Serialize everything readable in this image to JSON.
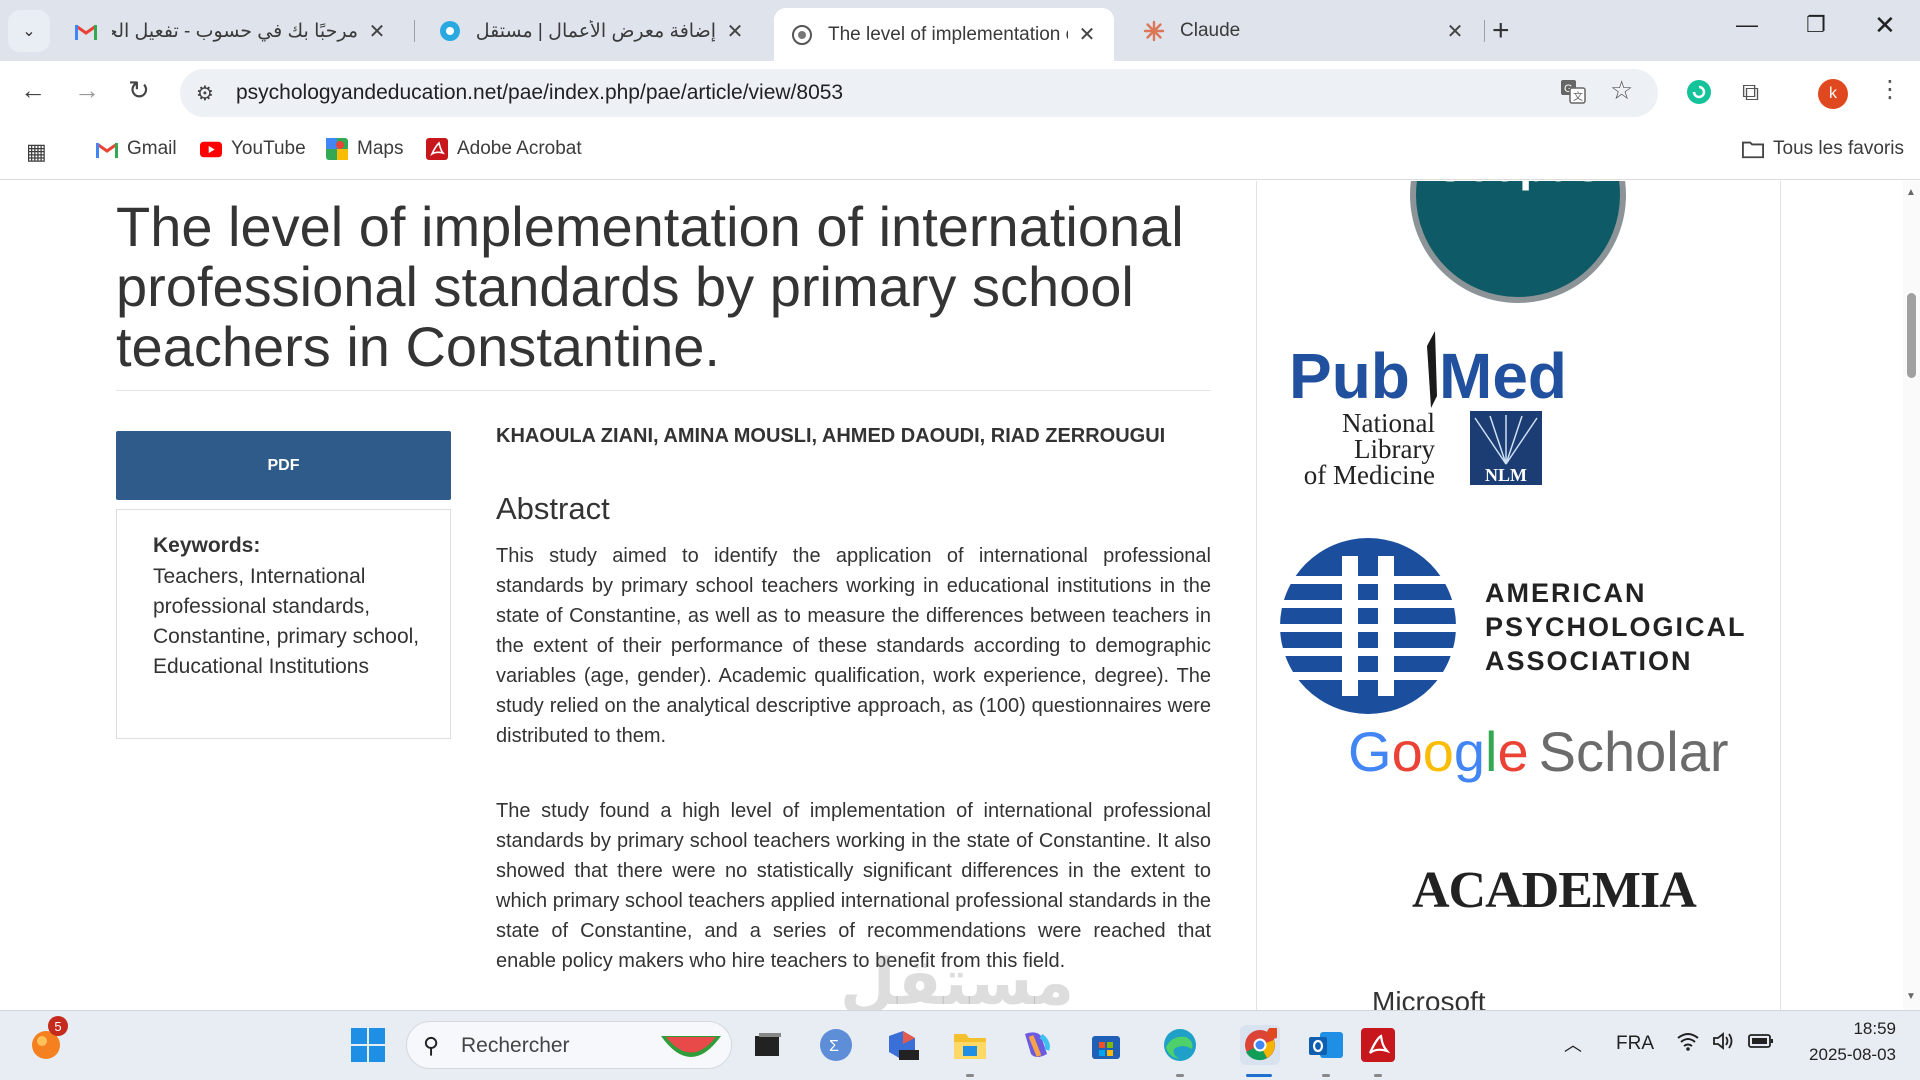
{
  "browser": {
    "tabs": [
      {
        "title": "مرحبًا بك في حسوب - تفعيل الحسا",
        "icon": "gmail-icon"
      },
      {
        "title": "إضافة معرض الأعمال | مستقل",
        "icon": "mostaql-icon"
      },
      {
        "title": "The level of implementation of i",
        "icon": "globe-icon"
      },
      {
        "title": "Claude",
        "icon": "claude-icon"
      }
    ],
    "url": "psychologyandeducation.net/pae/index.php/pae/article/view/8053",
    "avatar_letter": "k",
    "bookmarks": [
      {
        "label": "Gmail",
        "icon": "gmail-icon"
      },
      {
        "label": "YouTube",
        "icon": "youtube-icon"
      },
      {
        "label": "Maps",
        "icon": "maps-icon"
      },
      {
        "label": "Adobe Acrobat",
        "icon": "acrobat-icon"
      }
    ],
    "all_bookmarks": "Tous les favoris"
  },
  "article": {
    "title": "The level of implementation of international professional standards by primary school teachers in Constantine.",
    "pdf_label": "PDF",
    "keywords_heading": "Keywords:",
    "keywords": "Teachers, International professional standards, Constantine, primary school, Educational Institutions",
    "authors": "KHAOULA ZIANI, AMINA MOUSLI, AHMED DAOUDI, RIAD ZERROUGUI",
    "abstract_heading": "Abstract",
    "abstract_p1": "This study aimed to identify the application of international professional standards by primary school teachers working in educational institutions in the state of Constantine, as well as to measure the differences between teachers in the extent of their performance of these standards according to demographic variables (age, gender). Academic qualification, work experience, degree). The study relied on the analytical descriptive approach, as (100) questionnaires were distributed to them.",
    "abstract_p2": "The study found a high level of implementation of international professional standards by primary school teachers working in the state of Constantine. It also showed that there were no statistically significant differences in the extent to which primary school teachers applied international professional standards in the state of Constantine, and a series of recommendations were reached that enable policy makers who hire teachers to benefit from this field."
  },
  "sidebar": {
    "scopus": "Scopus",
    "pubmed_pub": "Pub",
    "pubmed_med": "Med",
    "nlm_lines": [
      "National",
      "Library",
      "of Medicine"
    ],
    "nlm_badge": "NLM",
    "apa_lines": [
      "AMERICAN",
      "PSYCHOLOGICAL",
      "ASSOCIATION"
    ],
    "google": [
      "G",
      "o",
      "o",
      "g",
      "l",
      "e"
    ],
    "scholar": "Scholar",
    "academia": "ACADEMIA",
    "microsoft": "Microsoft"
  },
  "watermark": "مستقل",
  "taskbar": {
    "search_placeholder": "Rechercher",
    "notification_count": "5",
    "language": "FRA",
    "time": "18:59",
    "date": "2025-08-03"
  },
  "colors": {
    "pdf_button": "#2f5b8a",
    "scopus_teal": "#0e5a66",
    "pubmed_blue": "#20509e",
    "apa_blue": "#1b4f9e"
  }
}
